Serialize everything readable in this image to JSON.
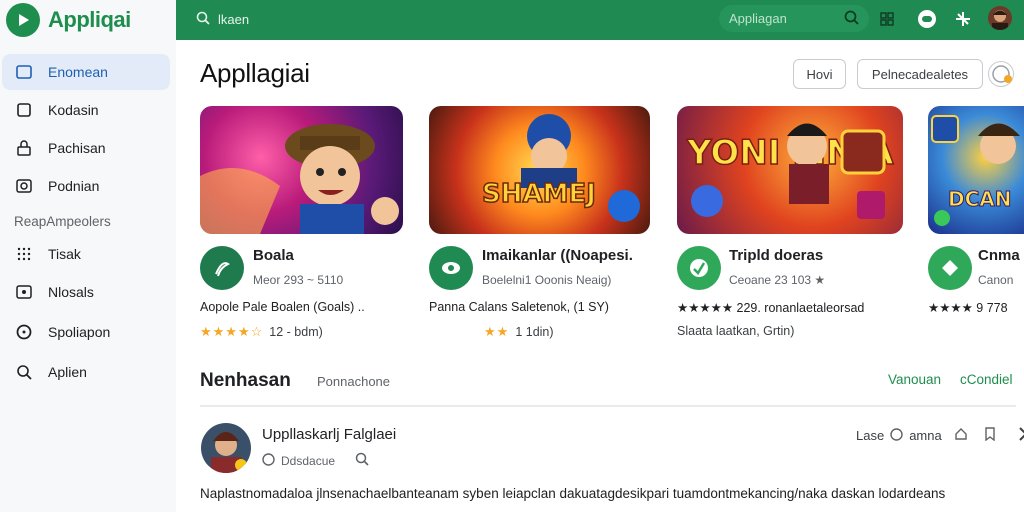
{
  "app": {
    "brand": "Appliqai"
  },
  "sidebar": {
    "items": [
      {
        "label": "Enomean",
        "icon": "rectangle-icon",
        "active": true
      },
      {
        "label": "Kodasin",
        "icon": "square-icon",
        "active": false
      },
      {
        "label": "Pachisan",
        "icon": "lock-icon",
        "active": false
      },
      {
        "label": "Podnian",
        "icon": "camera-icon",
        "active": false
      }
    ],
    "section": "ReapAmpeolers",
    "items2": [
      {
        "label": "Tisak",
        "icon": "grid-icon"
      },
      {
        "label": "Nlosals",
        "icon": "image-icon"
      },
      {
        "label": "Spoliapon",
        "icon": "circle-icon"
      },
      {
        "label": "Aplien",
        "icon": "search-icon"
      }
    ]
  },
  "topbar": {
    "search_placeholder": "lkaen",
    "search_right_placeholder": "Appliagan"
  },
  "main": {
    "title": "Appllagiai",
    "btn_how": "Hovi",
    "btn_pref": "Pelnecadealetes"
  },
  "cards": [
    {
      "title": "Boala",
      "sub": "Meor 293 ~ 5110",
      "desc": "Aopole Pale Boalen (Goals) ..",
      "stars": "★★★★☆",
      "rating": "12 - bdm)",
      "icon_color": "#1f8a52",
      "image_text": ""
    },
    {
      "title": "Imaikanlar ((Noapesi.",
      "sub": "Boelelni1 Ooonis Neaig)",
      "desc": "Panna Calans Saletenok, (1 SY)",
      "stars": "★★",
      "rating": "1 1din)",
      "icon_color": "#1f8a52",
      "image_text": "SHAMEJ"
    },
    {
      "title": "Tripld doeras",
      "sub": "Ceoane 23 103 ★",
      "desc": "★★★★★ 229. ronanlaetaleorsad",
      "stars": "",
      "rating": "Slaata laatkan, Grtin)",
      "icon_color": "#2fa85a",
      "image_text": "YONI MNIA"
    },
    {
      "title": "Cnma",
      "sub": "Canon",
      "desc": "★★★★ 9 778",
      "stars": "",
      "rating": "",
      "icon_color": "#2fa85a",
      "image_text": "DCAN"
    }
  ],
  "section": {
    "title": "Nenhasan",
    "sub": "Ponnachone",
    "link1": "Vanouan",
    "link2": "cCondiel"
  },
  "list": {
    "title": "Uppllaskarlj Falglaei",
    "meta": "Ddsdacue",
    "action_text": "Lase",
    "action_label": "amna",
    "desc": "Naplastnomadaloa jlnsenachaelbanteanam syben leiapclan dakuatagdesikpari tuamdontmekancing/naka daskan lodardeans"
  },
  "colors": {
    "accent": "#1f8a52",
    "star": "#f5a623",
    "active_nav": "#e3ebf8"
  }
}
